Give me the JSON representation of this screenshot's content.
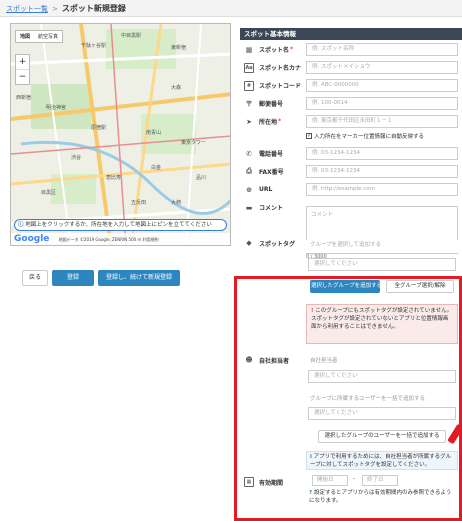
{
  "breadcrumb": {
    "parent": "スポット一覧",
    "separator": ">",
    "current": "スポット新規登録"
  },
  "map": {
    "tabs": [
      "地図",
      "航空写真"
    ],
    "zoom_in": "+",
    "zoom_out": "−",
    "place_labels": [
      "中目黒駅",
      "千駄ヶ谷駅",
      "東新宿",
      "西新宿",
      "大森",
      "明治神宮",
      "渋谷",
      "原宿駅",
      "南青山",
      "恵比寿",
      "白金",
      "目黒区",
      "東京タワー",
      "大崎",
      "品川",
      "五反田"
    ],
    "note": "地図上をクリックするか、所在地を入力して地図上にピンを立ててください",
    "footer_brand": "Google",
    "footer_text": "地図データ ©2019 Google, ZENRIN   500 m   利用規約"
  },
  "actions": {
    "back": "戻る",
    "register": "登録",
    "register_continue": "登録し、続けて新規登録"
  },
  "panel": {
    "title": "スポット基本情報",
    "fields": [
      {
        "label": "スポット名",
        "required": "*",
        "placeholder": "例. スポット名称",
        "icon": "building-icon"
      },
      {
        "label": "スポット名カナ",
        "required": "",
        "placeholder": "例. スポットメイショウ",
        "icon": "kana-icon"
      },
      {
        "label": "スポットコード",
        "required": "",
        "placeholder": "例. ABC-0000000",
        "icon": "hash-icon"
      },
      {
        "label": "郵便番号",
        "required": "",
        "placeholder": "例. 100-0014",
        "icon": "postcode-icon"
      },
      {
        "label": "所在地",
        "required": "*",
        "placeholder": "例. 東京都千代田区永田町１－１",
        "icon": "location-arrow-icon"
      },
      {
        "label": "電話番号",
        "required": "",
        "placeholder": "例. 03-1234-1234",
        "icon": "phone-icon"
      },
      {
        "label": "FAX番号",
        "required": "",
        "placeholder": "例. 03-1234-1234",
        "icon": "fax-icon"
      },
      {
        "label": "URL",
        "required": "",
        "placeholder": "例. http://example.com",
        "icon": "globe-icon"
      },
      {
        "label": "コメント",
        "required": "",
        "placeholder": "コメント",
        "icon": "comment-icon"
      }
    ],
    "address_checkbox": "入力所在をマーカー位置情報に自動反映する",
    "comment_count": "0 / 3000"
  },
  "tags": {
    "label": "スポットタグ",
    "group_placeholder": "グループを選択して追加する",
    "select_placeholder": "選択してください",
    "add_selected": "選択したグループを追加する",
    "toggle_all": "全グループ選択/解除",
    "warning": "このグループにもスポットタグが設定されていません。スポットタグが設定されていないとアプリと位置情報画面から利用することはできません。",
    "warning_icon": "!"
  },
  "assignee": {
    "label": "自社担当者",
    "section_label": "自社担当者",
    "select_placeholder": "選択してください",
    "user_label": "グループに所属するユーザーを一括で追加する",
    "user_select_placeholder": "選択してください",
    "bulk_add": "選択したグループのユーザーを一括で追加する",
    "info": "アプリで利用するためには、自社担当者が所属するグループに対してスポットタグを設定してください。",
    "info_icon": "i"
  },
  "validity": {
    "label": "有効期間",
    "start": "開始日",
    "tilde": "-",
    "end": "終了日",
    "hint": "設定するとアプリからは有効期間内のみ参照できるようになります。",
    "hint_icon": "?"
  }
}
